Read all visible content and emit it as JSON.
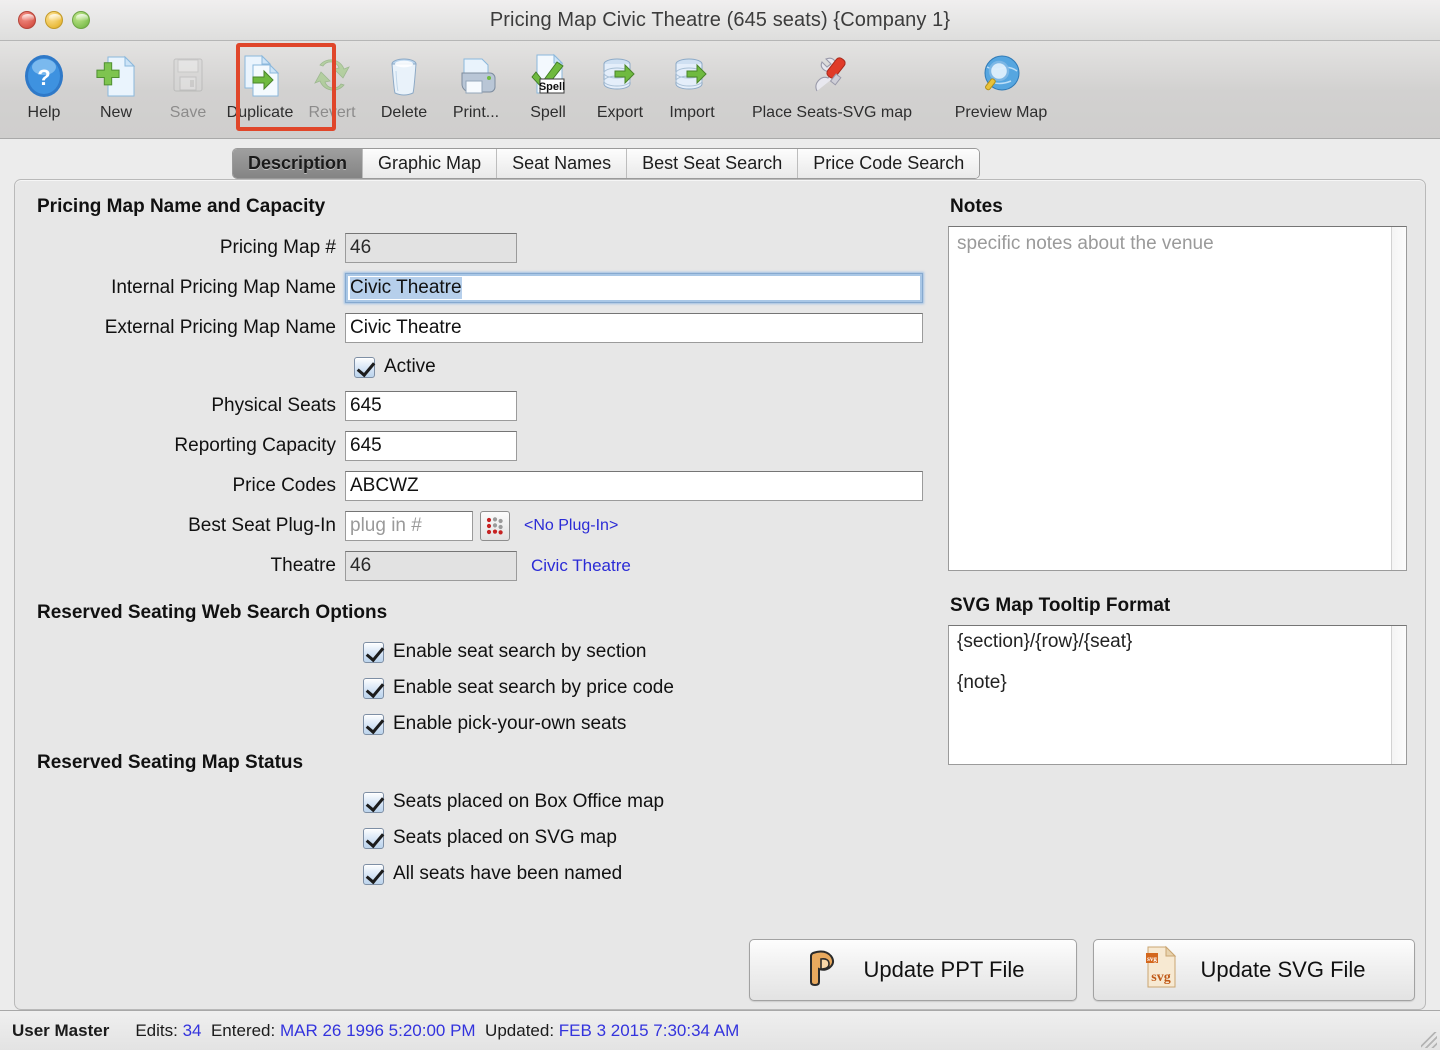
{
  "window": {
    "title": "Pricing Map Civic Theatre (645 seats) {Company 1}",
    "traffic": {
      "close": "close",
      "minimize": "minimize",
      "zoom": "zoom"
    }
  },
  "toolbar": {
    "highlight_color": "#e0462a",
    "highlighted_item": "Duplicate",
    "items": [
      {
        "label": "Help",
        "icon": "help-question-icon",
        "enabled": true
      },
      {
        "label": "New",
        "icon": "new-document-plus-icon",
        "enabled": true
      },
      {
        "label": "Save",
        "icon": "floppy-disk-icon",
        "enabled": false
      },
      {
        "label": "Duplicate",
        "icon": "duplicate-document-icon",
        "enabled": true
      },
      {
        "label": "Revert",
        "icon": "revert-arrows-icon",
        "enabled": false
      },
      {
        "label": "Delete",
        "icon": "trash-can-icon",
        "enabled": true
      },
      {
        "label": "Print...",
        "icon": "printer-icon",
        "enabled": true
      },
      {
        "label": "Spell",
        "icon": "spell-check-icon",
        "enabled": true
      },
      {
        "label": "Export",
        "icon": "database-export-icon",
        "enabled": true
      },
      {
        "label": "Import",
        "icon": "database-import-icon",
        "enabled": true
      },
      {
        "label": "Place Seats-SVG map",
        "icon": "wrench-screwdriver-icon",
        "enabled": true
      },
      {
        "label": "Preview Map",
        "icon": "globe-magnifier-icon",
        "enabled": true
      }
    ]
  },
  "tabs": {
    "active": "Description",
    "items": [
      {
        "label": "Description"
      },
      {
        "label": "Graphic Map"
      },
      {
        "label": "Seat Names"
      },
      {
        "label": "Best Seat Search"
      },
      {
        "label": "Price Code Search"
      }
    ]
  },
  "form": {
    "section_title": "Pricing Map Name and Capacity",
    "pricing_map_number": {
      "label": "Pricing Map #",
      "value": "46"
    },
    "internal_name": {
      "label": "Internal Pricing Map Name",
      "value": "Civic Theatre"
    },
    "external_name": {
      "label": "External Pricing Map Name",
      "value": "Civic Theatre"
    },
    "active": {
      "label": "Active",
      "checked": true
    },
    "physical_seats": {
      "label": "Physical Seats",
      "value": "645"
    },
    "reporting_capacity": {
      "label": "Reporting Capacity",
      "value": "645"
    },
    "price_codes": {
      "label": "Price Codes",
      "value": "ABCWZ"
    },
    "best_seat_plugin": {
      "label": "Best Seat Plug-In",
      "value": "",
      "placeholder": "plug in #",
      "status": "<No Plug-In>",
      "picker_icon": "seat-grid-icon"
    },
    "theatre": {
      "label": "Theatre",
      "value": "46",
      "link": "Civic Theatre"
    }
  },
  "web_search_options": {
    "title": "Reserved Seating Web Search Options",
    "items": [
      {
        "label": "Enable seat search by section",
        "checked": true
      },
      {
        "label": "Enable seat search by price code",
        "checked": true
      },
      {
        "label": "Enable pick-your-own seats",
        "checked": true
      }
    ]
  },
  "map_status": {
    "title": "Reserved Seating Map Status",
    "items": [
      {
        "label": "Seats placed on Box Office map",
        "checked": true
      },
      {
        "label": "Seats placed on SVG map",
        "checked": true
      },
      {
        "label": "All seats have been named",
        "checked": true
      }
    ]
  },
  "notes": {
    "title": "Notes",
    "value": "",
    "placeholder": "specific notes about the venue"
  },
  "tooltip_format": {
    "title": "SVG Map Tooltip Format",
    "line1": "{section}/{row}/{seat}",
    "line2": "{note}"
  },
  "actions": {
    "update_ppt": {
      "label": "Update PPT File",
      "icon": "powerpoint-icon"
    },
    "update_svg": {
      "label": "Update SVG File",
      "icon": "svg-file-icon"
    }
  },
  "statusbar": {
    "user": "User Master",
    "edits_label": "Edits:",
    "edits_value": "34",
    "entered_label": "Entered:",
    "entered_value": "MAR 26 1996 5:20:00 PM",
    "updated_label": "Updated:",
    "updated_value": "FEB 3 2015 7:30:34 AM"
  }
}
